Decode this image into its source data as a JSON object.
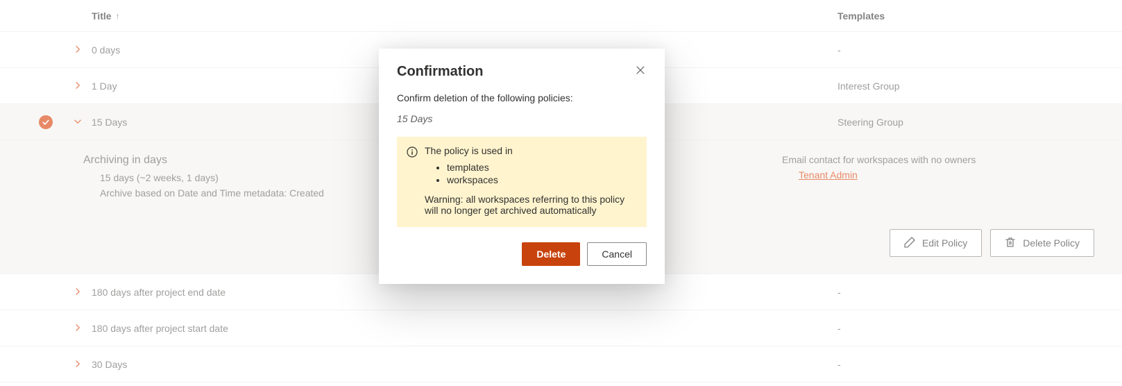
{
  "headers": {
    "title": "Title",
    "templates": "Templates"
  },
  "rows": [
    {
      "title": "0 days",
      "templates": "-",
      "expanded": false,
      "selected": false
    },
    {
      "title": "1 Day",
      "templates": "Interest Group",
      "expanded": false,
      "selected": false
    },
    {
      "title": "15 Days",
      "templates": "Steering Group",
      "expanded": true,
      "selected": true
    },
    {
      "title": "180 days after project end date",
      "templates": "-",
      "expanded": false,
      "selected": false
    },
    {
      "title": "180 days after project start date",
      "templates": "-",
      "expanded": false,
      "selected": false
    },
    {
      "title": "30 Days",
      "templates": "-",
      "expanded": false,
      "selected": false
    }
  ],
  "details": {
    "heading": "Archiving in days",
    "line1": "15 days (~2 weeks, 1 days)",
    "line2": "Archive based on Date and Time metadata:  Created",
    "rightHeading": "Email contact for workspaces with no owners",
    "contactLink": "Tenant Admin",
    "editLabel": "Edit Policy",
    "deleteLabel": "Delete Policy"
  },
  "modal": {
    "title": "Confirmation",
    "message": "Confirm deletion of the following policies:",
    "itemLabel": "15 Days",
    "infoIntro": "The policy is used in",
    "infoItems": [
      "templates",
      "workspaces"
    ],
    "infoWarning": "Warning: all workspaces referring to this policy will no longer get archived automatically",
    "deleteLabel": "Delete",
    "cancelLabel": "Cancel"
  }
}
